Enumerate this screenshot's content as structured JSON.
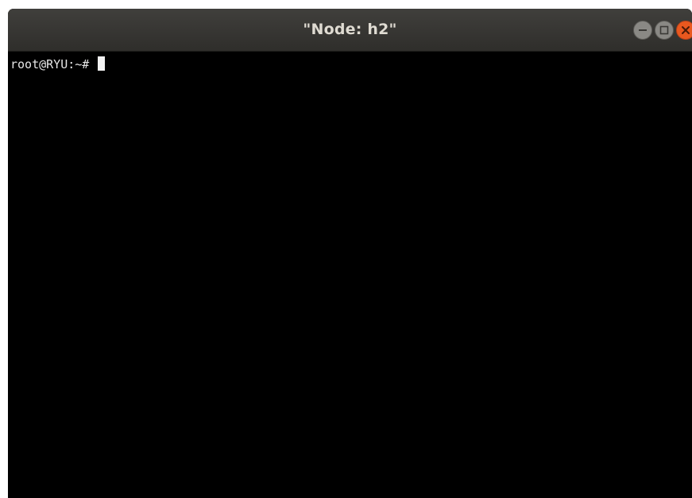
{
  "window": {
    "title": "\"Node: h2\"",
    "controls": {
      "minimize_icon": "minimize-icon",
      "maximize_icon": "maximize-icon",
      "close_icon": "close-icon",
      "close_color": "#e9581f"
    }
  },
  "terminal": {
    "prompt": "root@RYU:~# ",
    "background": "#000000",
    "foreground": "#e6e6e6"
  }
}
